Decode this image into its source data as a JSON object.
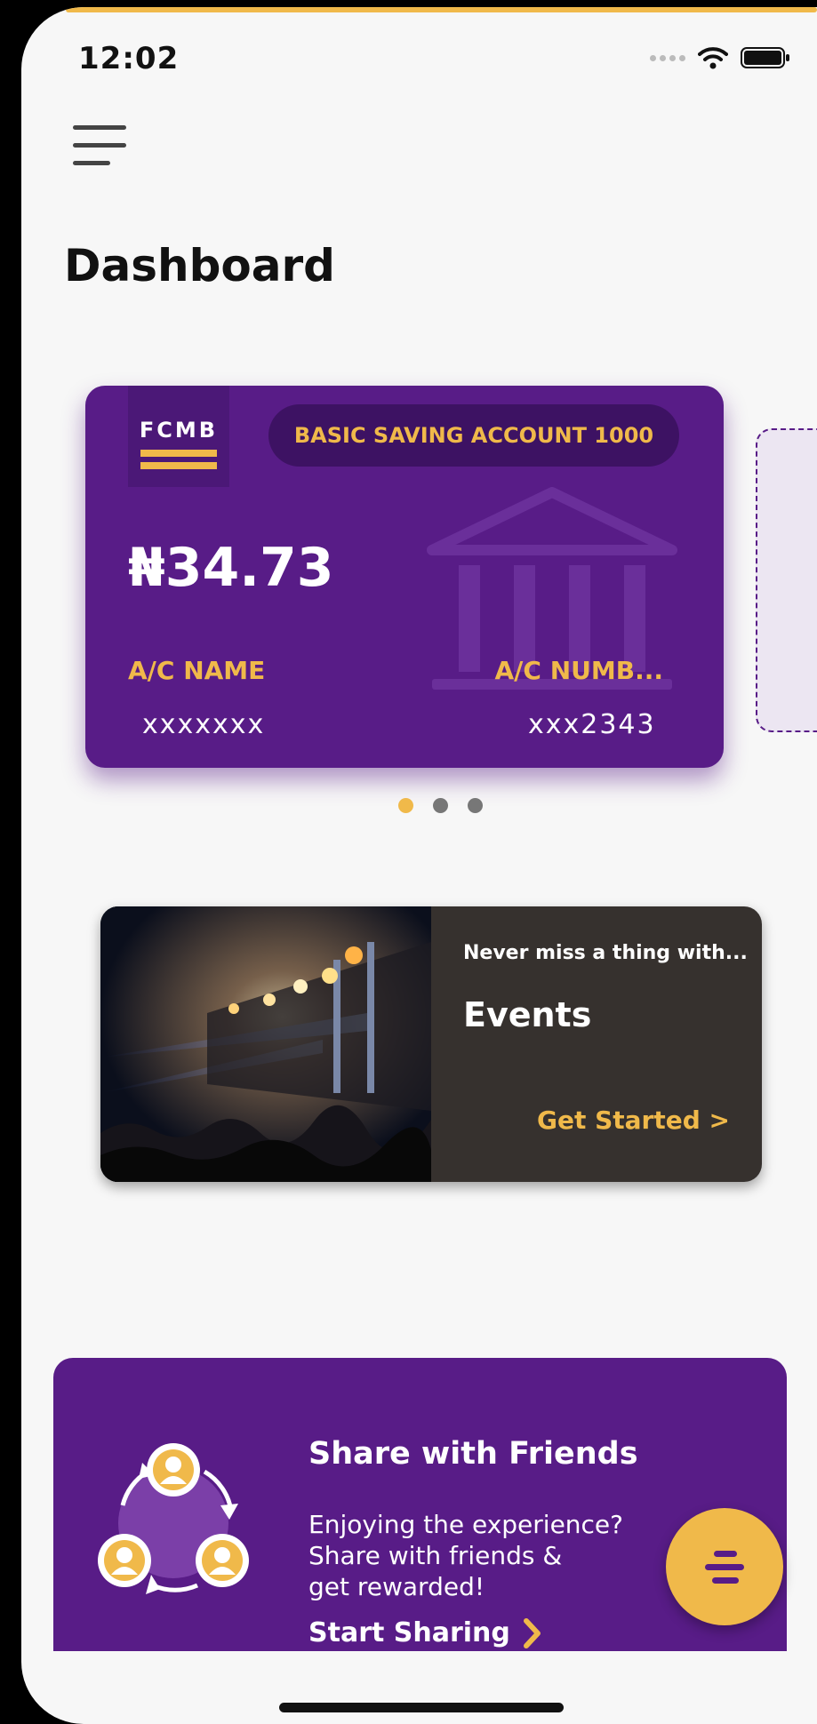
{
  "status_bar": {
    "time": "12:02"
  },
  "header": {
    "title": "Dashboard"
  },
  "account_card": {
    "bank": "FCMB",
    "account_type": "BASIC SAVING ACCOUNT 1000",
    "balance": "₦34.73",
    "name_label": "A/C NAME",
    "name_value": "xxxxxxx",
    "number_label": "A/C NUMB...",
    "number_value": "xxx2343"
  },
  "carousel": {
    "page_count": 3,
    "active_index": 0
  },
  "events_card": {
    "subtitle": "Never miss a thing with...",
    "title": "Events",
    "cta": "Get Started >"
  },
  "share_banner": {
    "title": "Share with Friends",
    "description_lines": [
      "Enjoying the experience?",
      "Share with friends &",
      "get rewarded!"
    ],
    "cta": "Start Sharing"
  },
  "colors": {
    "brand_purple": "#581c87",
    "accent_gold": "#f0b94a",
    "events_bg": "#36312e",
    "background": "#f7f7f7"
  },
  "icons": [
    "menu-icon",
    "wifi-icon",
    "battery-icon",
    "bank-building-icon",
    "people-share-icon",
    "chevron-right-icon",
    "fab-menu-icon"
  ]
}
